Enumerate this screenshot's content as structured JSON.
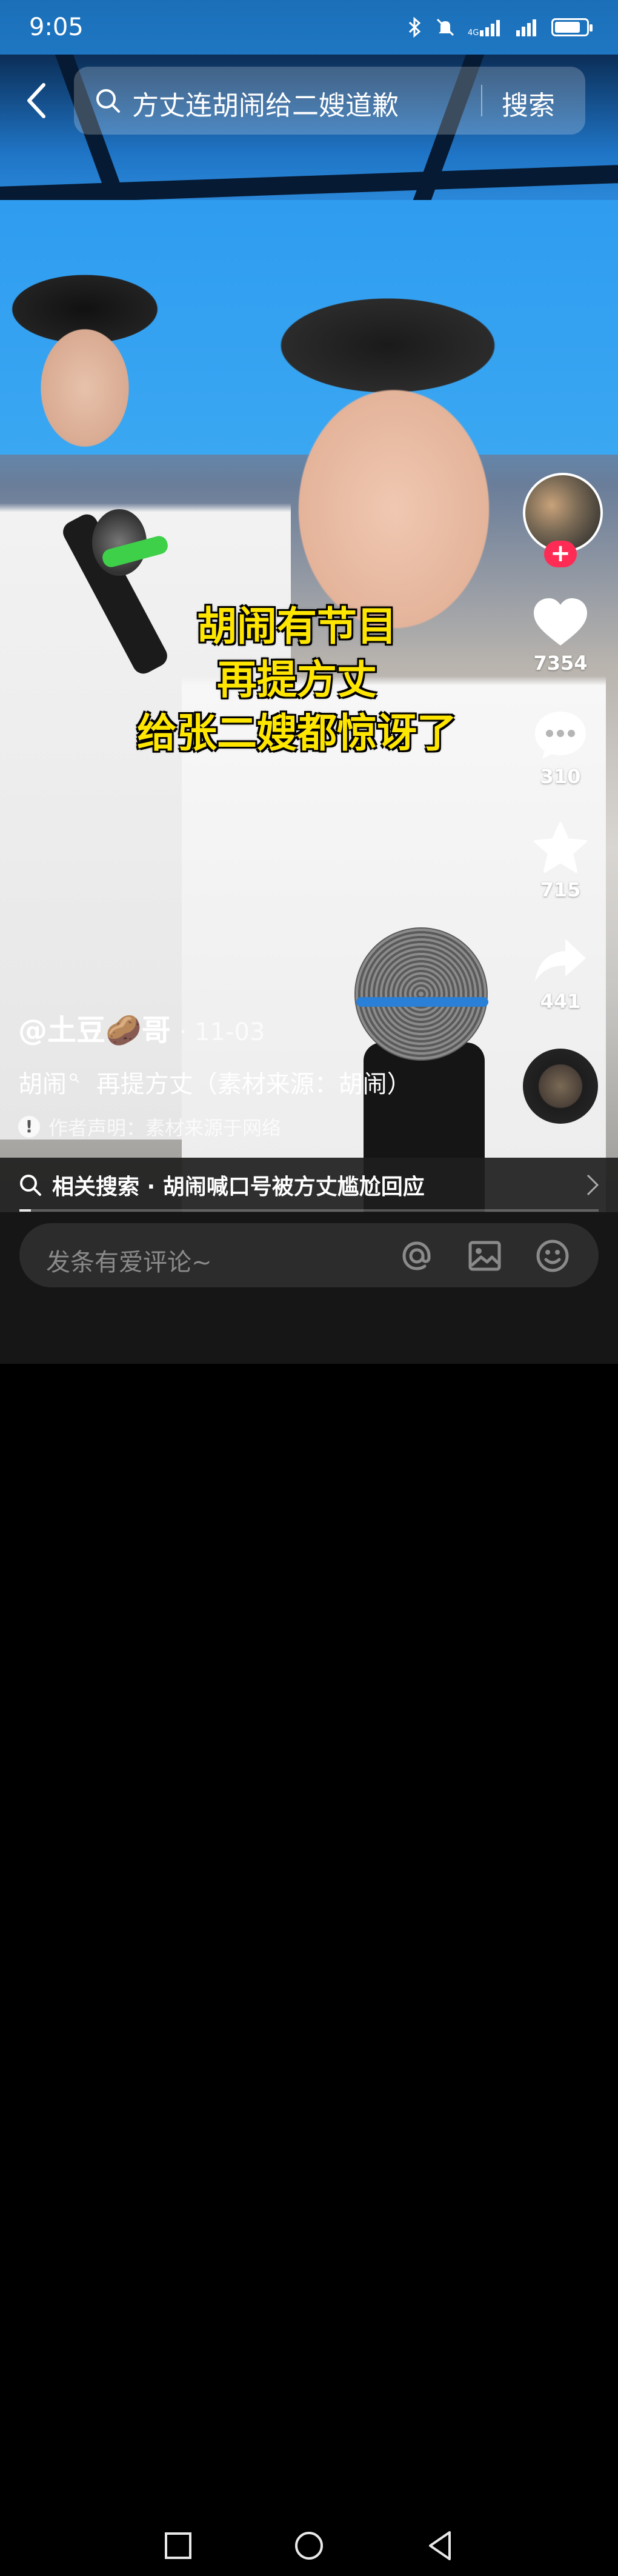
{
  "status_bar": {
    "time": "9:05",
    "icons": [
      "bluetooth-icon",
      "mute-icon",
      "signal-4g-icon",
      "signal-icon",
      "battery-charging-icon"
    ],
    "battery_level": 0.74
  },
  "search": {
    "query": "方丈连胡闹给二嫂道歉",
    "button_label": "搜索"
  },
  "video": {
    "caption_lines": [
      "胡闹有节目",
      "再提方丈",
      "给张二嫂都惊讶了"
    ]
  },
  "actions": {
    "likes": "7354",
    "comments": "310",
    "favorites": "715",
    "shares": "441",
    "follow_label": "+"
  },
  "meta": {
    "author_prefix": "@土豆",
    "author_emoji": "🥔",
    "author_suffix": "哥",
    "date": "· 11-03",
    "description_topic": "胡闹",
    "description_rest": "再提方丈（素材来源：胡闹）",
    "disclaimer": "作者声明：素材来源于网络"
  },
  "related": {
    "text": "相关搜索 · 胡闹喊口号被方丈尴尬回应"
  },
  "progress": {
    "fraction": 0.02
  },
  "comment": {
    "placeholder": "发条有爱评论~"
  },
  "colors": {
    "caption_yellow": "#ffe600",
    "follow_red": "#fe2c55"
  }
}
